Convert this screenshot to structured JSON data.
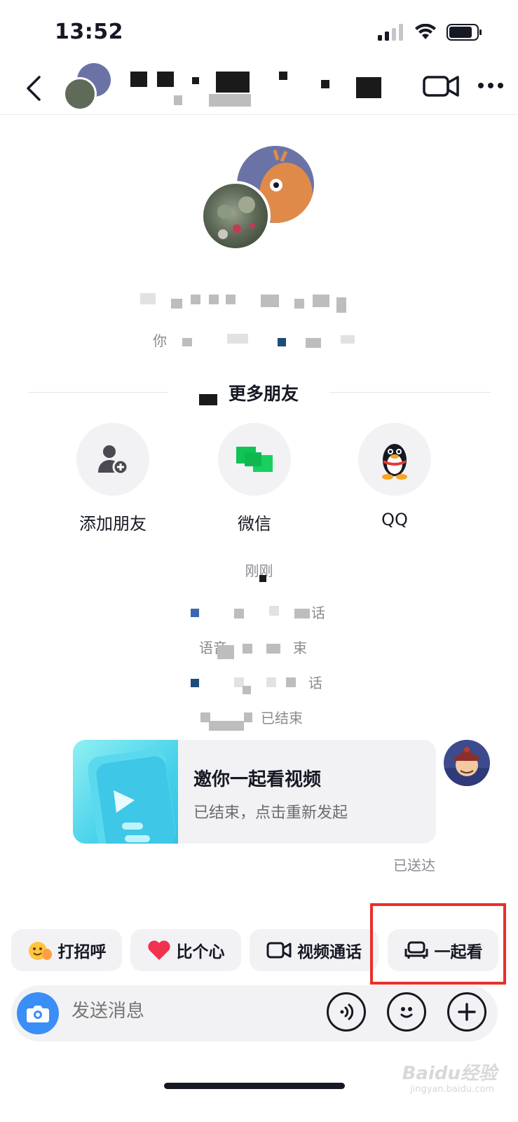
{
  "status_bar": {
    "time": "13:52",
    "icons": [
      "signal-icon",
      "wifi-icon",
      "battery-icon"
    ]
  },
  "nav": {
    "back_icon": "chevron-left-icon",
    "title": "",
    "actions": [
      "phone-icon",
      "video-camera-icon",
      "more-icon"
    ]
  },
  "profile": {
    "name": "",
    "subtitle_prefix": "你"
  },
  "share_section": {
    "heading": "更多朋友",
    "items": [
      {
        "label": "添加朋友",
        "icon": "add-friend-icon"
      },
      {
        "label": "微信",
        "icon": "wechat-icon"
      },
      {
        "label": "QQ",
        "icon": "qq-penguin-icon"
      }
    ]
  },
  "system_messages": [
    {
      "text": "刚刚"
    },
    {
      "text": "话"
    },
    {
      "text": "语音",
      "tail": "束"
    },
    {
      "text": "话"
    },
    {
      "text": "已结束"
    }
  ],
  "watch_card": {
    "title": "邀你一起看视频",
    "subtitle": "已结束，点击重新发起",
    "status": "已送达"
  },
  "quick_actions": [
    {
      "label": "打招呼",
      "icon": "wave-hand-icon"
    },
    {
      "label": "比个心",
      "icon": "heart-icon"
    },
    {
      "label": "视频通话",
      "icon": "video-call-icon"
    },
    {
      "label": "一起看",
      "icon": "sofa-icon"
    }
  ],
  "input": {
    "placeholder": "发送消息",
    "left_icon": "camera-icon",
    "right_icons": [
      "voice-icon",
      "emoji-icon",
      "plus-icon"
    ]
  },
  "colors": {
    "accent_blue": "#3a8ef6",
    "highlight_red": "#e8302a",
    "chip_bg": "#f2f2f4",
    "text_primary": "#161823",
    "text_secondary": "#8a8b91"
  },
  "watermark": {
    "brand": "Baidu经验",
    "url": "jingyan.baidu.com"
  }
}
